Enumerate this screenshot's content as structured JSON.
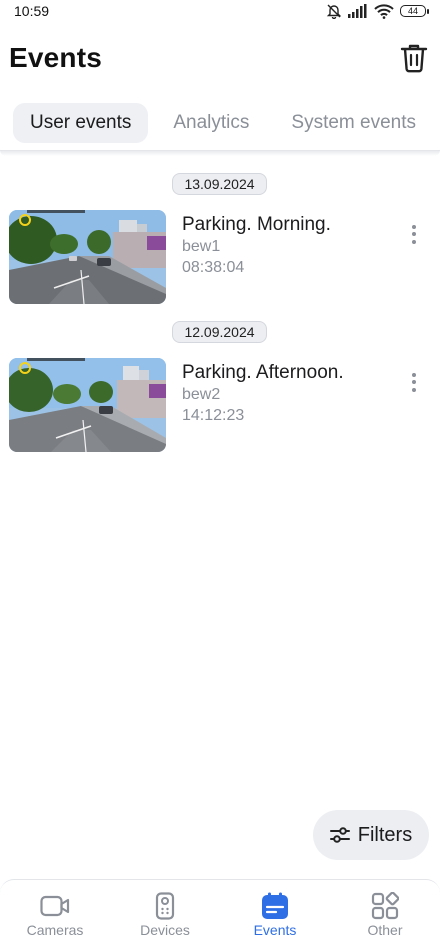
{
  "status_bar": {
    "time": "10:59",
    "battery": "44"
  },
  "header": {
    "title": "Events",
    "trash_icon": "trash-icon"
  },
  "tabs": [
    {
      "label": "User events",
      "active": true
    },
    {
      "label": "Analytics",
      "active": false
    },
    {
      "label": "System events",
      "active": false
    }
  ],
  "groups": [
    {
      "date": "13.09.2024",
      "events": [
        {
          "title": "Parking. Morning.",
          "camera": "bew1",
          "time": "08:38:04"
        }
      ]
    },
    {
      "date": "12.09.2024",
      "events": [
        {
          "title": "Parking. Afternoon.",
          "camera": "bew2",
          "time": "14:12:23"
        }
      ]
    }
  ],
  "filters_button": {
    "label": "Filters",
    "icon": "sliders-icon"
  },
  "bottom_nav": [
    {
      "label": "Cameras",
      "icon": "video-camera-icon",
      "active": false
    },
    {
      "label": "Devices",
      "icon": "remote-device-icon",
      "active": false
    },
    {
      "label": "Events",
      "icon": "calendar-icon",
      "active": true
    },
    {
      "label": "Other",
      "icon": "grid-shapes-icon",
      "active": false
    }
  ],
  "colors": {
    "accent": "#2f6fe5",
    "muted_text": "#8a8f98",
    "chip_bg": "#eceef2",
    "rec_indicator": "#f4d21a"
  }
}
